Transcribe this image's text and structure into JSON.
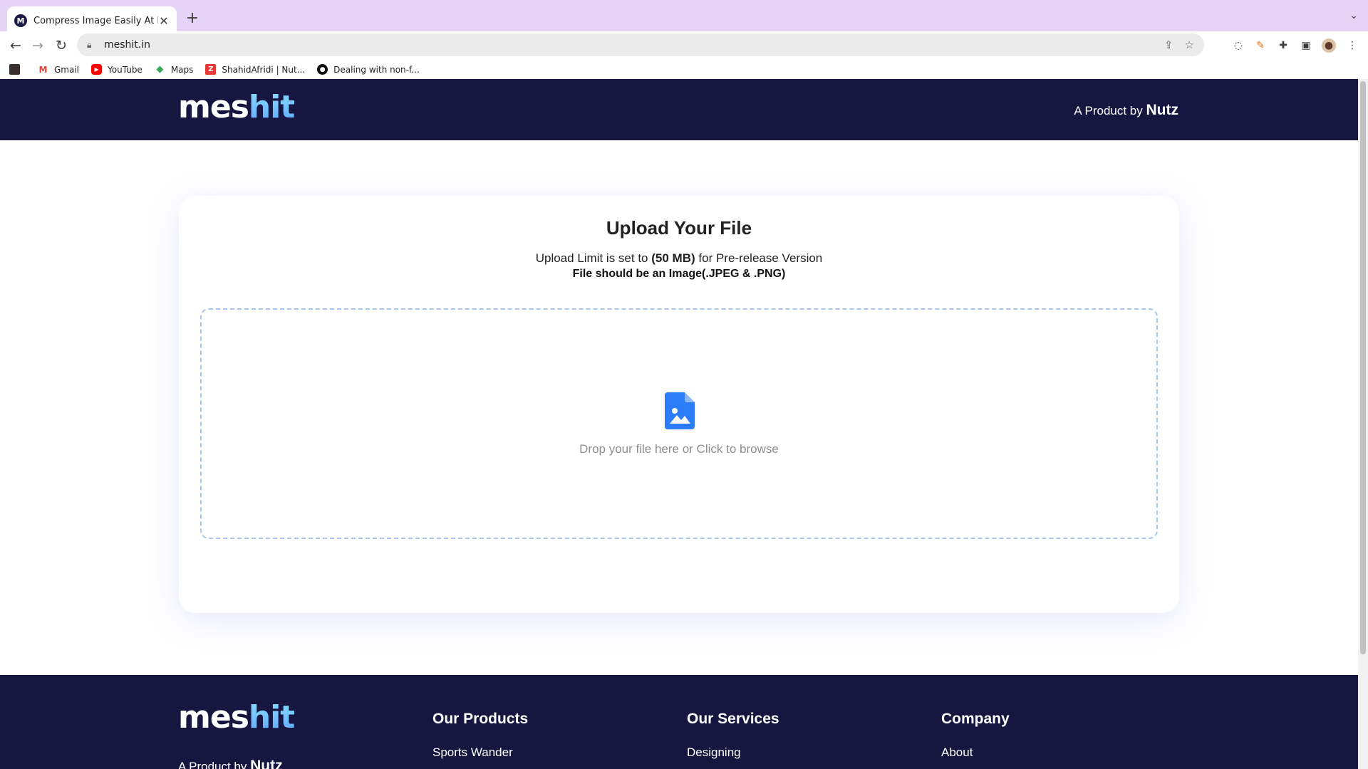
{
  "browser": {
    "tab_title": "Compress Image Easily At Best",
    "tab_favicon": "M",
    "url": "meshit.in",
    "bookmarks": [
      {
        "label": "Gmail",
        "icon": "gmail-icon",
        "color": "#ea4335"
      },
      {
        "label": "YouTube",
        "icon": "youtube-icon",
        "color": "#ff0000"
      },
      {
        "label": "Maps",
        "icon": "maps-icon",
        "color": "#34a853"
      },
      {
        "label": "ShahidAfridi | Nut...",
        "icon": "z-icon",
        "color": "#e53935"
      },
      {
        "label": "Dealing with non-f...",
        "icon": "github-icon",
        "color": "#111111"
      }
    ]
  },
  "header": {
    "logo_prefix": "mes",
    "logo_highlight": "hit",
    "product_prefix": "A Product by",
    "product_brand": "Nutz"
  },
  "upload": {
    "title": "Upload Your File",
    "limit_prefix": "Upload Limit is set to",
    "limit_value": "(50 MB)",
    "limit_suffix": "for Pre-release Version",
    "file_type": "File should be an Image(.JPEG & .PNG)",
    "drop_text": "Drop your file here or Click to browse"
  },
  "footer": {
    "logo_prefix": "mes",
    "logo_highlight": "hit",
    "product_prefix": "A Product by",
    "product_brand": "Nutz",
    "columns": [
      {
        "title": "Our Products",
        "items": [
          "Sports Wander"
        ]
      },
      {
        "title": "Our Services",
        "items": [
          "Designing"
        ]
      },
      {
        "title": "Company",
        "items": [
          "About"
        ]
      }
    ]
  },
  "colors": {
    "navy": "#161640",
    "accent_blue": "#2b7cf6",
    "dropzone_border": "#a7c6ee"
  }
}
